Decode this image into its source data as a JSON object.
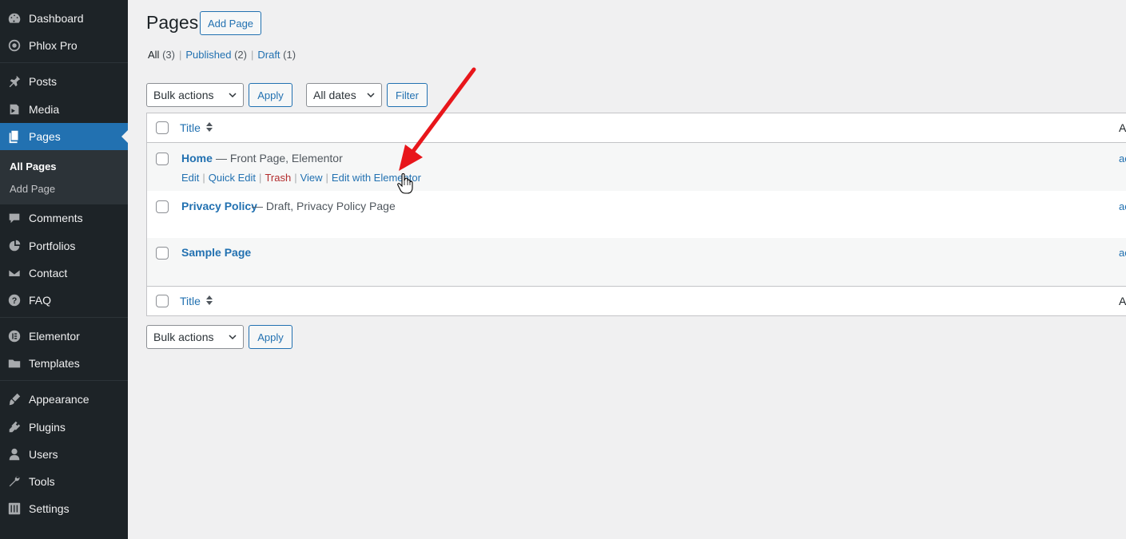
{
  "sidebar": {
    "items": [
      {
        "label": "Dashboard",
        "icon": "dashboard-icon"
      },
      {
        "label": "Phlox Pro",
        "icon": "phlox-icon"
      },
      {
        "label": "Posts",
        "icon": "pin-icon"
      },
      {
        "label": "Media",
        "icon": "media-icon"
      },
      {
        "label": "Pages",
        "icon": "pages-icon",
        "active": true
      },
      {
        "label": "Comments",
        "icon": "comment-icon"
      },
      {
        "label": "Portfolios",
        "icon": "portfolio-icon"
      },
      {
        "label": "Contact",
        "icon": "mail-icon"
      },
      {
        "label": "FAQ",
        "icon": "help-icon"
      },
      {
        "label": "Elementor",
        "icon": "elementor-icon"
      },
      {
        "label": "Templates",
        "icon": "folder-icon"
      },
      {
        "label": "Appearance",
        "icon": "brush-icon"
      },
      {
        "label": "Plugins",
        "icon": "plugin-icon"
      },
      {
        "label": "Users",
        "icon": "user-icon"
      },
      {
        "label": "Tools",
        "icon": "wrench-icon"
      },
      {
        "label": "Settings",
        "icon": "settings-icon"
      }
    ],
    "submenu": {
      "all_pages": "All Pages",
      "add_page": "Add Page"
    }
  },
  "header": {
    "title": "Pages",
    "add_button": "Add Page"
  },
  "filters": {
    "all": "All",
    "all_count": "(3)",
    "published": "Published",
    "published_count": "(2)",
    "draft": "Draft",
    "draft_count": "(1)",
    "sep": "|"
  },
  "toolbar": {
    "bulk_actions": "Bulk actions",
    "apply": "Apply",
    "all_dates": "All dates",
    "filter": "Filter"
  },
  "table": {
    "col_title": "Title",
    "col_author_partial": "A",
    "rows": [
      {
        "title": "Home",
        "state": "— Front Page, Elementor",
        "author": "ac",
        "actions": {
          "edit": "Edit",
          "quick_edit": "Quick Edit",
          "trash": "Trash",
          "view": "View",
          "edit_elementor": "Edit with Elementor"
        }
      },
      {
        "title": "Privacy Policy",
        "state": "— Draft, Privacy Policy Page",
        "author": "ac"
      },
      {
        "title": "Sample Page",
        "state": "",
        "author": "ac"
      }
    ]
  },
  "colors": {
    "accent": "#2271b1",
    "sidebar_bg": "#1d2327",
    "annotation_arrow": "#e8161b"
  }
}
